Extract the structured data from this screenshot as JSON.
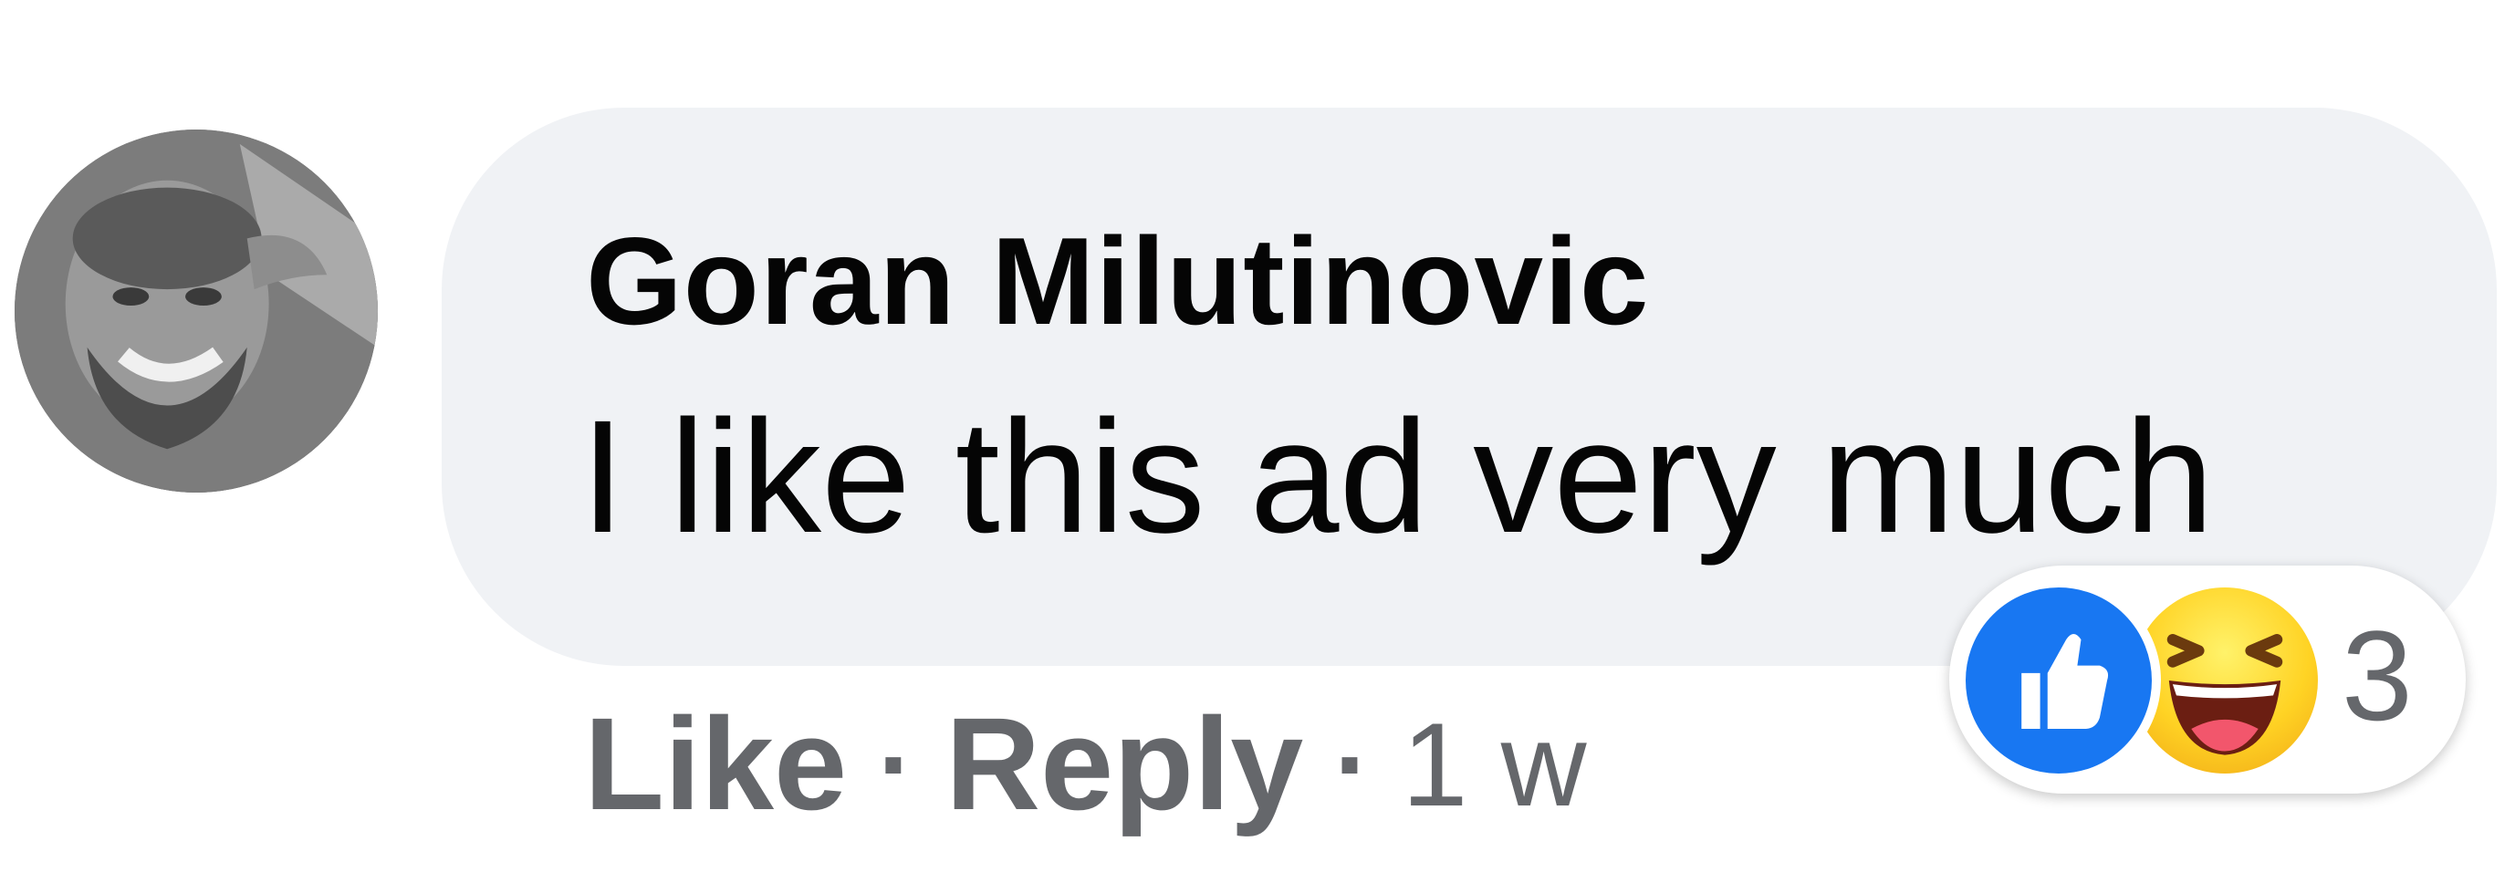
{
  "comment": {
    "author": "Goran Milutinovic",
    "text": "I like this ad very much",
    "actions": {
      "like_label": "Like",
      "separator": "·",
      "reply_label": "Reply",
      "time": "1 w"
    },
    "reactions": {
      "icons": [
        "like-icon",
        "haha-icon"
      ],
      "count": "3",
      "colors": {
        "like": "#1877f2",
        "haha": "#ffd324"
      }
    }
  },
  "colors": {
    "bubble_background": "#f0f2f5",
    "primary_text": "#050505",
    "secondary_text": "#65676b"
  }
}
